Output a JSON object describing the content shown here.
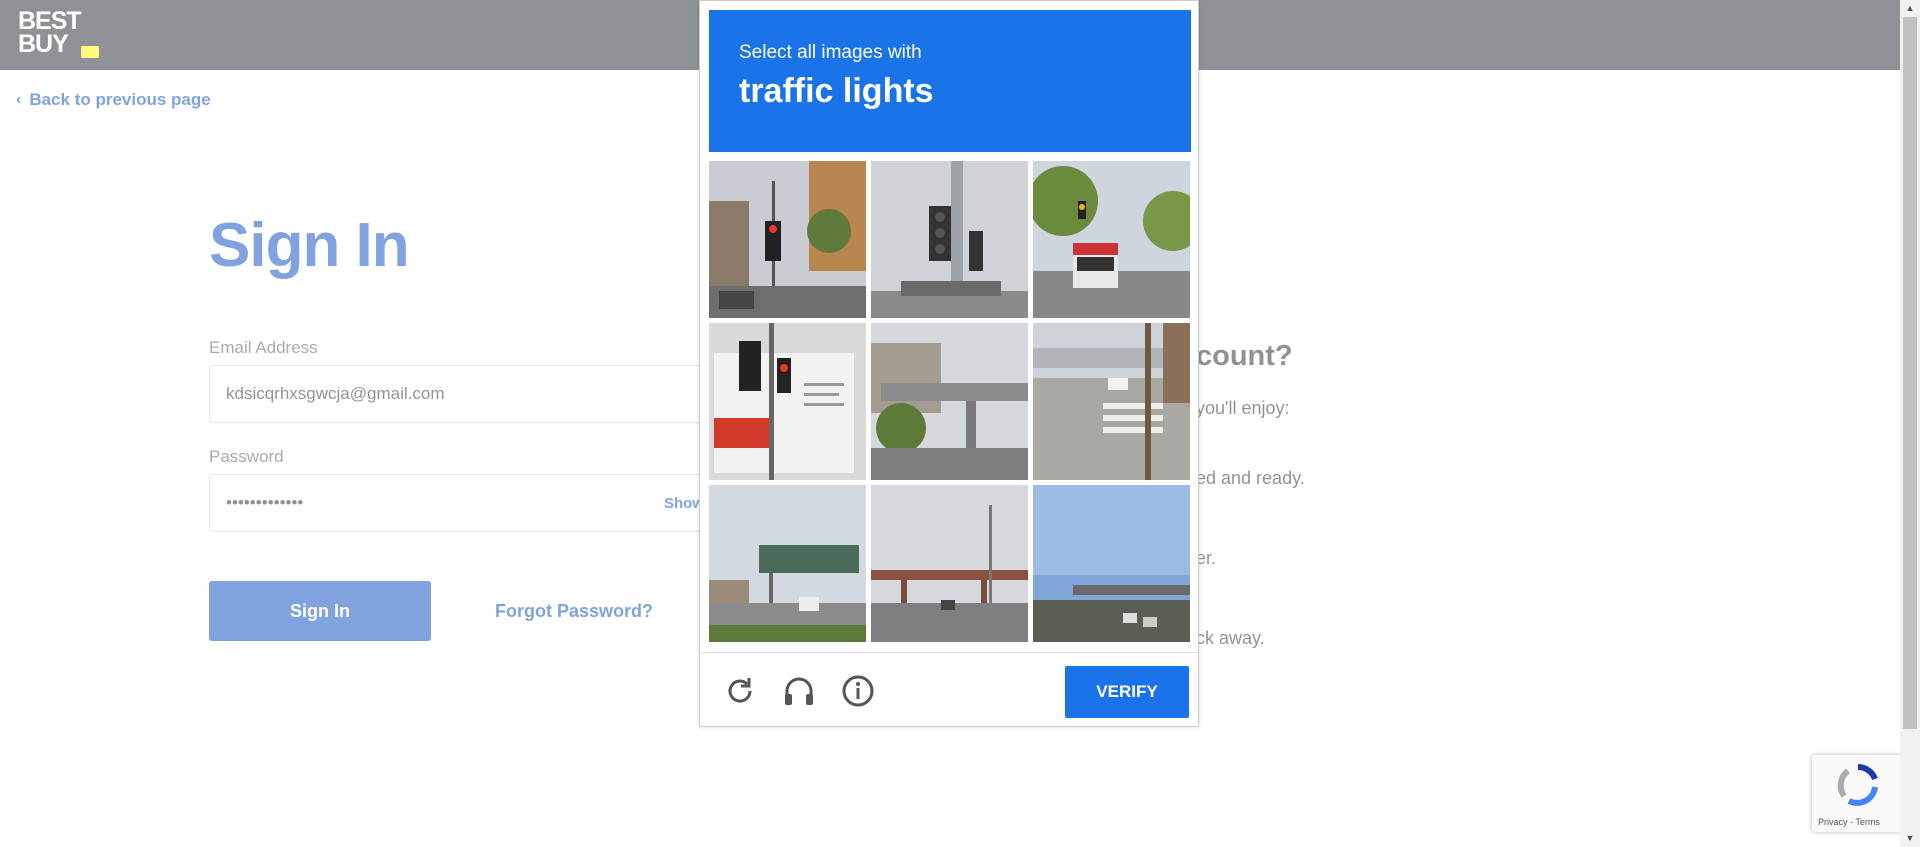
{
  "header": {
    "logo_line1": "BEST",
    "logo_line2": "BUY"
  },
  "nav": {
    "back_label": "Back to previous page"
  },
  "signin": {
    "title": "Sign In",
    "email_label": "Email Address",
    "email_value": "kdsicqrhxsgwcja@gmail.com",
    "password_label": "Password",
    "password_value": "•••••••••••••",
    "show_label": "Show",
    "signin_button": "Sign In",
    "forgot_link": "Forgot Password?"
  },
  "create_account": {
    "title_fragment": "count?",
    "line1": "you'll enjoy:",
    "line2": "ed and ready.",
    "line3": "er.",
    "line4": "ck away."
  },
  "captcha": {
    "instruction": "Select all images with",
    "object": "traffic lights",
    "verify_label": "VERIFY",
    "footer_icons": [
      "reload-icon",
      "headphones-icon",
      "info-icon"
    ]
  },
  "recaptcha_badge": {
    "terms": "Privacy - Terms"
  },
  "colors": {
    "brand_blue": "#0046be",
    "header_bg": "#1d252c",
    "logo_tag": "#fff200",
    "captcha_blue": "#1a73e8"
  }
}
